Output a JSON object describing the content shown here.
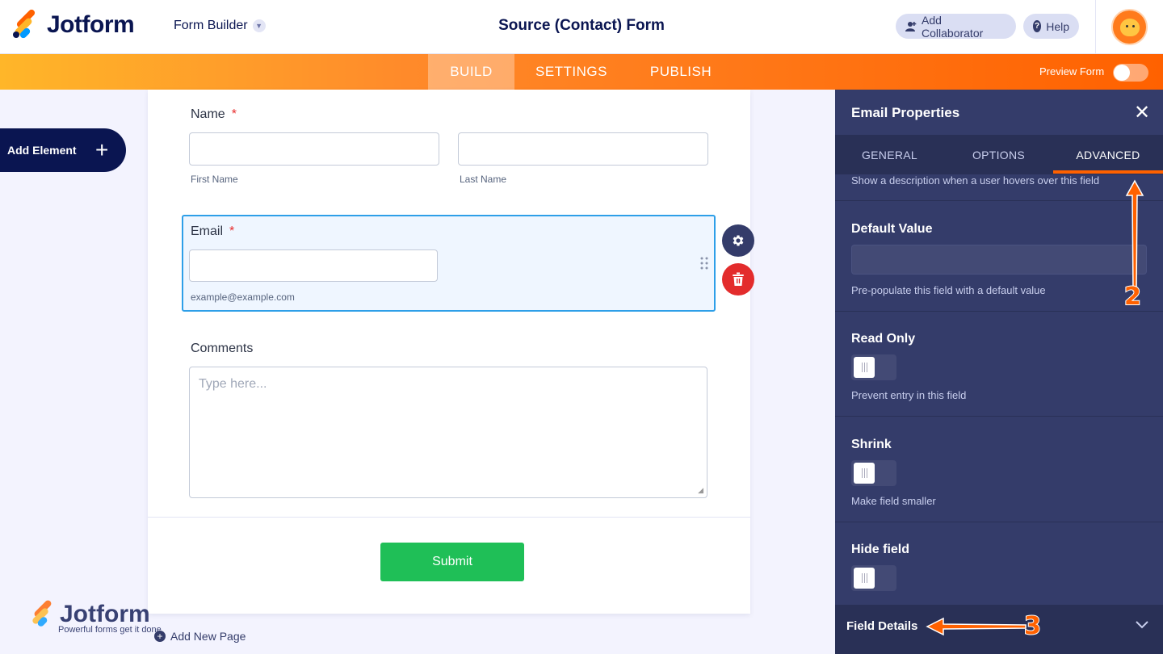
{
  "header": {
    "logo_text": "Jotform",
    "form_builder": "Form Builder",
    "form_title": "Source (Contact) Form",
    "add_collaborator": "Add Collaborator",
    "help": "Help"
  },
  "nav": {
    "tabs": [
      "BUILD",
      "SETTINGS",
      "PUBLISH"
    ],
    "active": "BUILD",
    "preview_label": "Preview Form"
  },
  "sidebar": {
    "add_element": "Add Element"
  },
  "form": {
    "name_label": "Name",
    "required_mark": "*",
    "first_name": "First Name",
    "last_name": "Last Name",
    "email_label": "Email",
    "email_hint": "example@example.com",
    "comments_label": "Comments",
    "comments_placeholder": "Type here...",
    "submit": "Submit",
    "add_new_page": "Add New Page"
  },
  "watermark": {
    "logo_text": "Jotform",
    "tagline": "Powerful forms get it done"
  },
  "panel": {
    "title": "Email Properties",
    "tabs": [
      "GENERAL",
      "OPTIONS",
      "ADVANCED"
    ],
    "active_tab": "ADVANCED",
    "hover_desc": "Show a description when a user hovers over this field",
    "default_value_label": "Default Value",
    "default_value_desc": "Pre-populate this field with a default value",
    "read_only_label": "Read Only",
    "read_only_desc": "Prevent entry in this field",
    "shrink_label": "Shrink",
    "shrink_desc": "Make field smaller",
    "hide_label": "Hide field",
    "field_details": "Field Details"
  },
  "annotations": {
    "step2": "2",
    "step3": "3"
  },
  "colors": {
    "accent": "#ff6100",
    "panel_bg": "#343c6a",
    "submit": "#1fbf57",
    "delete": "#e32c2c",
    "selected_border": "#2e9fe8"
  }
}
